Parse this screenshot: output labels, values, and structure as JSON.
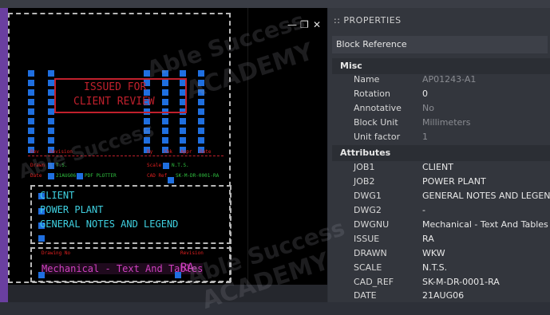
{
  "window": {
    "minimize_icon": "minimize-icon",
    "restore_icon": "restore-icon",
    "close_icon": "close-icon"
  },
  "drawing": {
    "stamp_line1": "ISSUED FOR",
    "stamp_line2": "CLIENT REVIEW",
    "title_line1": "CLIENT",
    "title_line2": "POWER PLANT",
    "title_line3": "GENERAL NOTES AND LEGEND",
    "dwg_no_text": "Mechanical - Text And Tables",
    "issue_text": "RA",
    "header_labels": [
      "Rev",
      "Revision",
      "By",
      "Chk",
      "Appr",
      "Date"
    ],
    "label_drawn": "Drawn",
    "label_date": "Date",
    "label_scale": "Scale",
    "label_cadref": "CAD Ref",
    "val_drawn": "T.S.",
    "val_date": "21AUG06",
    "val_scale": "N.T.S.",
    "val_plotter": "PDF PLOTTER",
    "val_cadref": "SK-M-DR-0001-RA",
    "label_dwgno": "Drawing No",
    "label_revision": "Revision"
  },
  "properties": {
    "title": ":: PROPERTIES",
    "selection": "Block Reference",
    "misc_header": "Misc",
    "misc": [
      {
        "key": "Name",
        "value": "AP01243-A1",
        "dim": true
      },
      {
        "key": "Rotation",
        "value": "0",
        "dim": false
      },
      {
        "key": "Annotative",
        "value": "No",
        "dim": true
      },
      {
        "key": "Block Unit",
        "value": "Millimeters",
        "dim": true
      },
      {
        "key": "Unit factor",
        "value": "1",
        "dim": true
      }
    ],
    "attributes_header": "Attributes",
    "attributes": [
      {
        "key": "JOB1",
        "value": "CLIENT"
      },
      {
        "key": "JOB2",
        "value": "POWER PLANT"
      },
      {
        "key": "DWG1",
        "value": "GENERAL NOTES AND LEGEND"
      },
      {
        "key": "DWG2",
        "value": "-"
      },
      {
        "key": "DWGNU",
        "value": "Mechanical - Text And Tables"
      },
      {
        "key": "ISSUE",
        "value": "RA"
      },
      {
        "key": "DRAWN",
        "value": "WKW"
      },
      {
        "key": "SCALE",
        "value": "N.T.S."
      },
      {
        "key": "CAD_REF",
        "value": "SK-M-DR-0001-RA"
      },
      {
        "key": "DATE",
        "value": "21AUG06"
      }
    ]
  },
  "watermark": {
    "line1": "Able Success",
    "line2": "ACADEMY"
  },
  "colors": {
    "blue_grip": "#1f6fe0",
    "stamp_red": "#c0202c",
    "cyan_text": "#3fd0e0",
    "magenta_text": "#d040c0",
    "green_text": "#30c040",
    "red_text": "#e02020"
  }
}
